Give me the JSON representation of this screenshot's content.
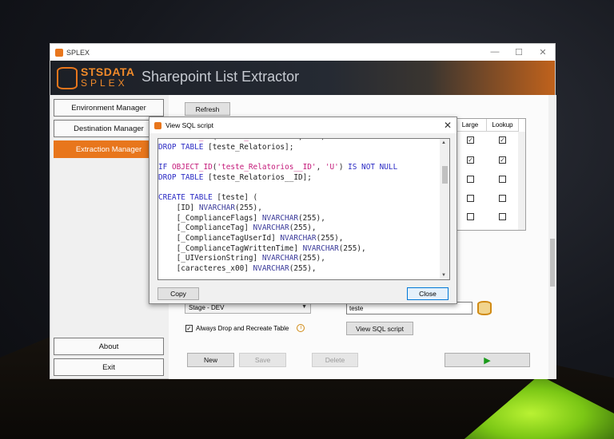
{
  "window": {
    "title": "SPLEX",
    "controls": [
      "—",
      "☐",
      "✕"
    ]
  },
  "banner": {
    "logo_top": "STSDATA",
    "logo_bottom": "SPLEX",
    "title": "Sharepoint List Extractor"
  },
  "nav": {
    "environment": "Environment Manager",
    "destination": "Destination Manager",
    "extraction": "Extraction Manager",
    "about": "About",
    "exit": "Exit"
  },
  "content": {
    "refresh": "Refresh",
    "grid": {
      "col_large": "Large",
      "col_lookup": "Lookup",
      "rows": [
        {
          "large": true,
          "lookup": true
        },
        {
          "large": true,
          "lookup": true
        },
        {
          "large": false,
          "lookup": false
        },
        {
          "large": false,
          "lookup": false
        },
        {
          "large": false,
          "lookup": false
        }
      ]
    },
    "environment_select": "Stage - DEV",
    "table_name": "teste",
    "always_drop_label": "Always Drop and Recreate Table",
    "always_drop_checked": true,
    "view_sql": "View SQL script",
    "new": "New",
    "save": "Save",
    "delete": "Delete",
    "run_icon": "▶"
  },
  "dialog": {
    "title": "View SQL script",
    "copy": "Copy",
    "close": "Close",
    "sql_lines": [
      "IF OBJECT_ID('teste_Relatorios', 'U') IS NOT NULL",
      "DROP TABLE [teste_Relatorios];",
      "",
      "IF OBJECT_ID('teste_Relatorios__ID', 'U') IS NOT NULL",
      "DROP TABLE [teste_Relatorios__ID];",
      "",
      "CREATE TABLE [teste] (",
      "    [ID] NVARCHAR(255),",
      "    [_ComplianceFlags] NVARCHAR(255),",
      "    [_ComplianceTag] NVARCHAR(255),",
      "    [_ComplianceTagUserId] NVARCHAR(255),",
      "    [_ComplianceTagWrittenTime] NVARCHAR(255),",
      "    [_UIVersionString] NVARCHAR(255),",
      "    [caracteres_x00] NVARCHAR(255),"
    ]
  },
  "colors": {
    "accent": "#e8761c",
    "keyword": "#2a2ac4",
    "string": "#c41a7a"
  }
}
